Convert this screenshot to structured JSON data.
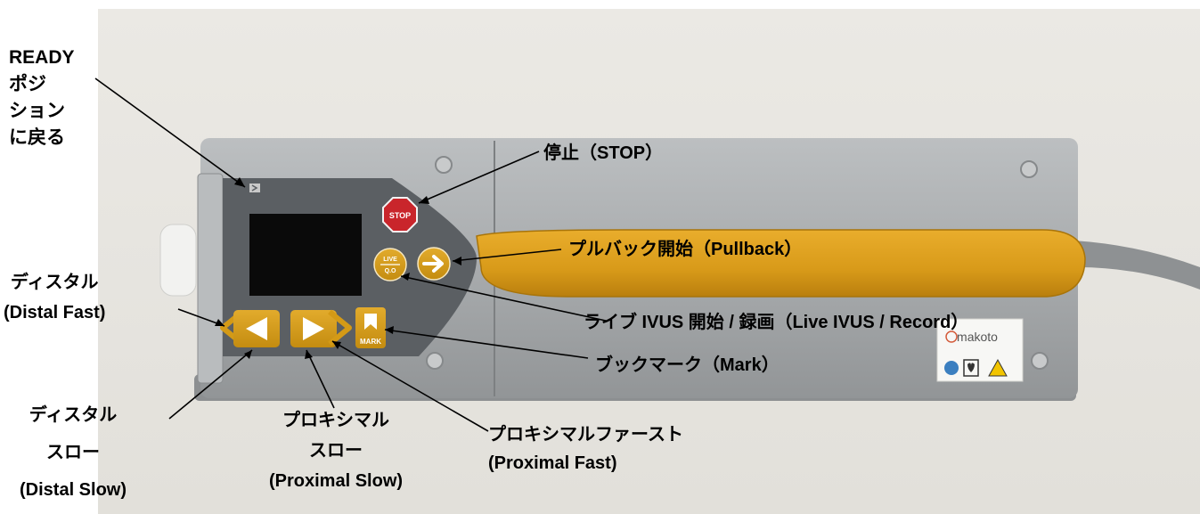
{
  "device": {
    "stop_button_label": "STOP",
    "live_button_label_top": "LIVE",
    "live_button_label_bottom": "Q.O",
    "mark_button_label": "MARK",
    "brand_logo": "makoto",
    "icons": [
      "ready-icon",
      "stop-icon",
      "live-record-icon",
      "pullback-arrow-icon",
      "distal-fast-icon",
      "distal-slow-icon",
      "proximal-slow-icon",
      "proximal-fast-icon",
      "bookmark-icon",
      "bf-type-symbol-icon",
      "defibrillation-proof-icon",
      "laser-warning-icon"
    ],
    "colors": {
      "button_gold": "#d49a16",
      "handle_orange": "#e0a020",
      "stop_red": "#c9252b",
      "panel_dark": "#5b5f63",
      "housing": "#a7aaac",
      "screen": "#0a0a0a"
    }
  },
  "labels": {
    "ready": [
      "READY",
      "ポジ",
      "ション",
      "に戻る"
    ],
    "stop": "停止（STOP）",
    "pullback": "プルバック開始（Pullback）",
    "live_record": "ライブ IVUS 開始 / 録画（Live IVUS / Record）",
    "distal_fast": [
      "ディスタル",
      "(Distal Fast)"
    ],
    "bookmark": "ブックマーク（Mark）",
    "distal_slow": [
      "ディスタル",
      "スロー",
      "(Distal Slow)"
    ],
    "proximal_slow": [
      "プロキシマル",
      "スロー",
      "(Proximal Slow)"
    ],
    "proximal_fast": [
      "プロキシマルファースト",
      "(Proximal Fast)"
    ]
  }
}
